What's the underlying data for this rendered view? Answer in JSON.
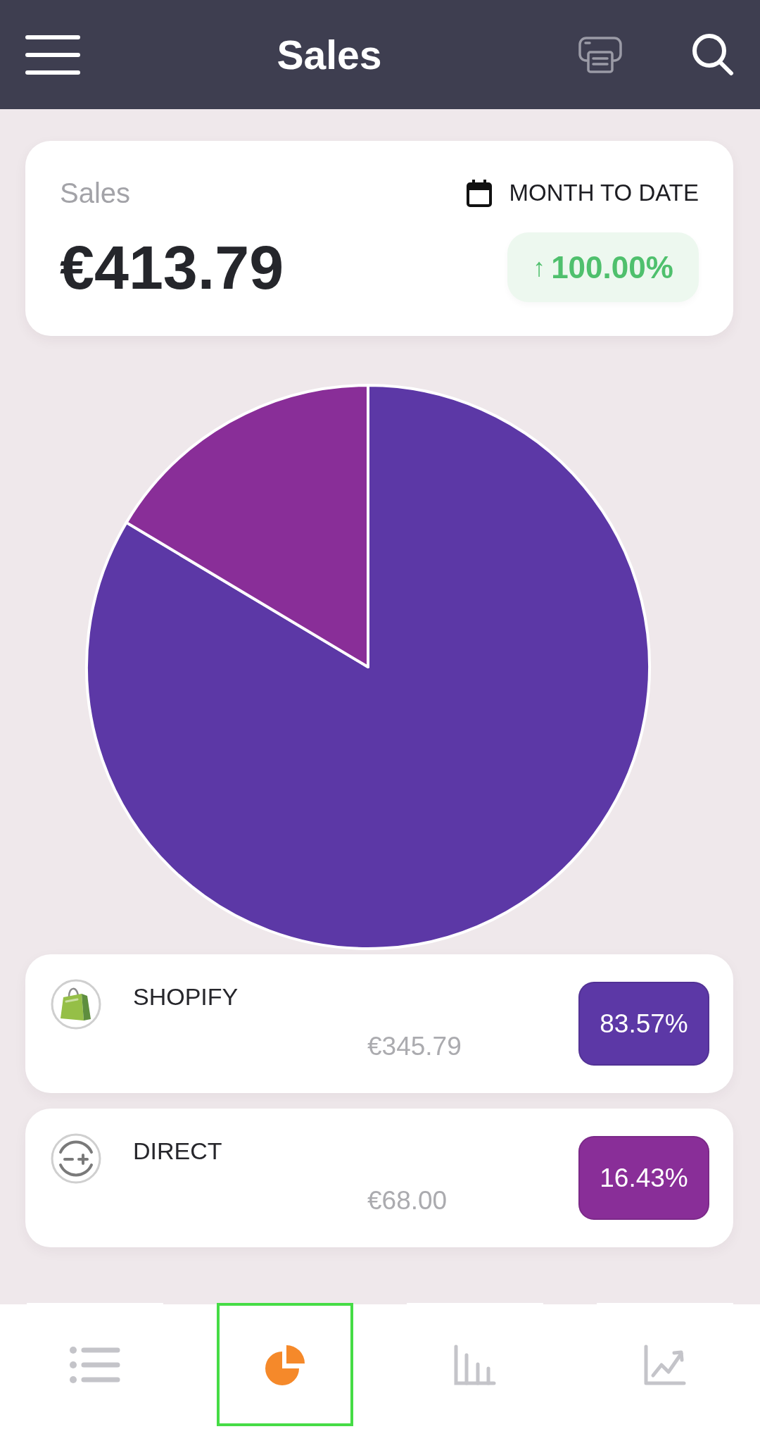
{
  "header": {
    "title": "Sales",
    "print_button": {
      "disabled": true
    }
  },
  "summary": {
    "label": "Sales",
    "period": "MONTH TO DATE",
    "amount": "€413.79",
    "change": {
      "arrow": "↑",
      "value": "100.00%"
    }
  },
  "chart": {
    "chart_data": {
      "type": "pie",
      "categories": [
        "SHOPIFY",
        "DIRECT"
      ],
      "values": [
        83.57,
        16.43
      ]
    }
  },
  "sources": [
    {
      "kind": "bag",
      "amount": "€345.79",
      "share": "83.57%",
      "color": "#5c38a6"
    },
    {
      "kind": "dial",
      "amount": "€68.00",
      "share": "16.43%",
      "color": "#892e98"
    }
  ],
  "bottom_nav": [
    {
      "kind": "list",
      "selected": false
    },
    {
      "kind": "pie",
      "selected": true
    },
    {
      "kind": "bars",
      "selected": false
    },
    {
      "kind": "trend",
      "selected": false
    }
  ]
}
